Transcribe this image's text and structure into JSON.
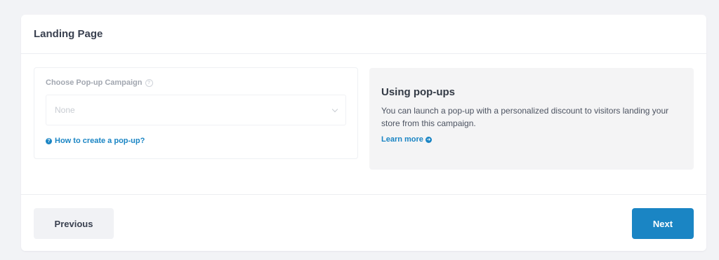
{
  "header": {
    "title": "Landing Page"
  },
  "popup_select": {
    "label": "Choose Pop-up Campaign",
    "help_icon": "question-circle-icon",
    "selected_value": "None",
    "options": [
      "None"
    ],
    "help_link": "How to create a pop-up?"
  },
  "info": {
    "title": "Using pop-ups",
    "text": "You can launch a pop-up with a personalized discount to visitors landing your store from this campaign.",
    "learn_more": "Learn more"
  },
  "footer": {
    "previous_label": "Previous",
    "next_label": "Next"
  },
  "colors": {
    "accent": "#1a85c4",
    "background": "#f2f3f6",
    "info_panel": "#f4f4f5",
    "secondary_button": "#f1f2f5"
  }
}
